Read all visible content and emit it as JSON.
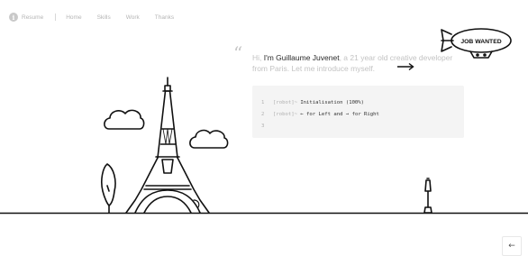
{
  "nav": {
    "items": [
      {
        "label": "Resume"
      },
      {
        "label": "Home"
      },
      {
        "label": "Skills"
      },
      {
        "label": "Work"
      },
      {
        "label": "Thanks"
      }
    ]
  },
  "intro": {
    "greeting": "Hi, ",
    "name": "I'm Guillaume Juvenet",
    "rest": ", a 21 year old creative developer from Paris. Let me introduce myself."
  },
  "airship": {
    "banner": "JOB WANTED"
  },
  "console": {
    "lines": [
      {
        "num": "1",
        "prompt": "[robot]~ ",
        "text": "Initialisation (100%)"
      },
      {
        "num": "2",
        "prompt": "[robot]~ ",
        "arrow_left": "←",
        "text_a": " for Left and ",
        "arrow_right": "→",
        "text_b": " for Right"
      },
      {
        "num": "3",
        "prompt": "",
        "text": ""
      }
    ]
  },
  "icons": {
    "info": "i",
    "back": "←"
  },
  "colors": {
    "ink": "#1a1a1a",
    "muted": "#c3c3c3",
    "console_bg": "#f4f4f4"
  }
}
